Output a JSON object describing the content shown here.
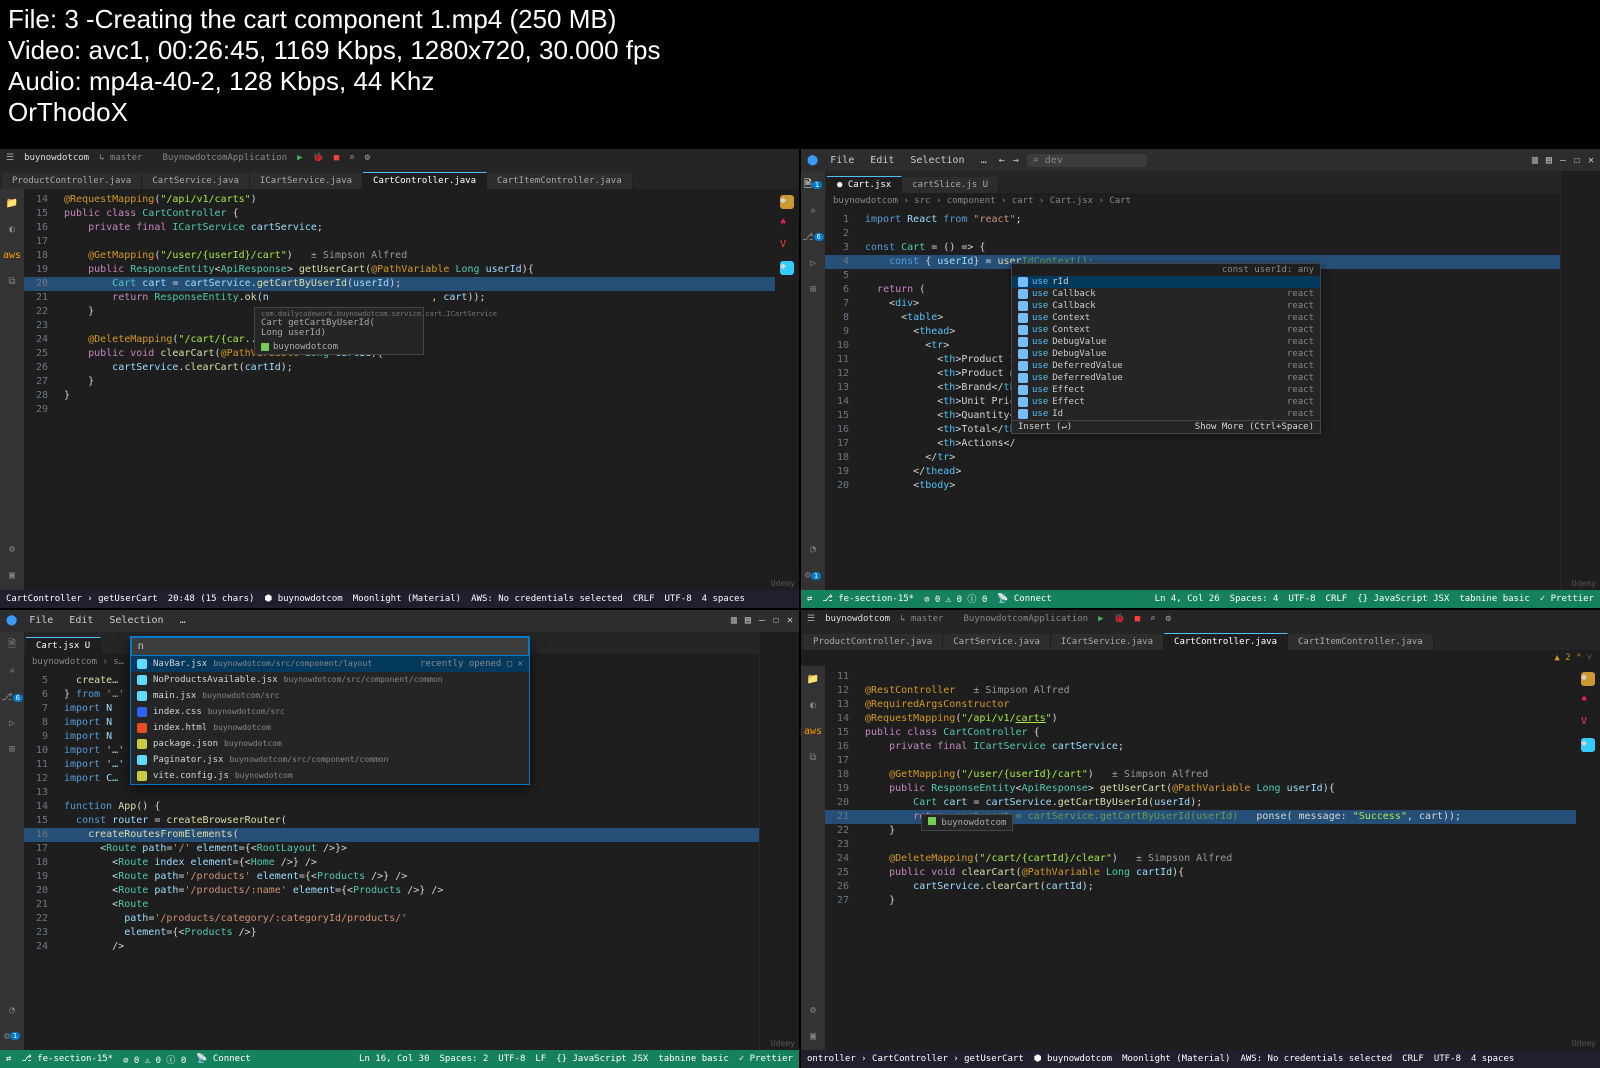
{
  "overlay": {
    "file_line": "File: 3 -Creating the cart component 1.mp4 (250 MB)",
    "video_line": "Video: avc1, 00:26:45, 1169 Kbps, 1280x720, 30.000 fps",
    "audio_line": "Audio: mp4a-40-2, 128 Kbps, 44 Khz",
    "author": "OrThodoX"
  },
  "pane_tl": {
    "project": "buynowdotcom",
    "branch": "master",
    "run_config": "BuynowdotcomApplication",
    "tabs": [
      {
        "label": "ProductController.java",
        "active": false
      },
      {
        "label": "CartService.java",
        "active": false
      },
      {
        "label": "ICartService.java",
        "active": false
      },
      {
        "label": "CartController.java",
        "active": true
      },
      {
        "label": "CartItemController.java",
        "active": false
      }
    ],
    "breadcrumb": "CartController  ›  getUserCart",
    "code_lines": [
      {
        "n": 14,
        "html": "<span class='ann'>@RequestMapping</span>(<span class='str'>\"/api/v1/carts\"</span>)"
      },
      {
        "n": 15,
        "html": "<span class='kw'>public class</span> <span class='type'>CartController</span> {"
      },
      {
        "n": 16,
        "html": "    <span class='kw'>private final</span> <span class='type'>ICartService</span> <span class='attr'>cartService</span>;"
      },
      {
        "n": 17,
        "html": ""
      },
      {
        "n": 18,
        "html": "    <span class='ann'>@GetMapping</span>(<span class='str'>\"/user/{userId}/cart\"</span>)   <span class='avatar'>± Simpson Alfred</span>"
      },
      {
        "n": 19,
        "html": "    <span class='kw'>public</span> <span class='type'>ResponseEntity</span>&lt;<span class='type'>ApiResponse</span>&gt; <span class='fn'>getUserCart</span>(<span class='ann'>@PathVariable</span> <span class='type'>Long</span> <span class='attr'>userId</span>){"
      },
      {
        "n": 20,
        "html": "        <span class='type'>Cart</span> <span class='attr'>cart</span> = <span class='attr'>cartService</span>.<span class='fn'>getCartByUserId</span>(<span class='attr'>userId</span>);",
        "hl": true
      },
      {
        "n": 21,
        "html": "        <span class='kw'>return</span> <span class='type'>ResponseEntity</span>.<span class='fn'>ok</span>(<span class='attr'>n</span>                           , <span class='attr'>cart</span>));"
      },
      {
        "n": 22,
        "html": "    }"
      },
      {
        "n": 23,
        "html": ""
      },
      {
        "n": 24,
        "html": "    <span class='ann'>@DeleteMapping</span>(<span class='str'>\"/cart/{car...\"</span>)"
      },
      {
        "n": 25,
        "html": "    <span class='kw'>public void</span> <span class='fn'>clearCart</span>(<span class='ann'>@PathVariable</span> <span class='type'>Long</span> <span class='attr'>cartId</span>){"
      },
      {
        "n": 26,
        "html": "        <span class='attr'>cartService</span>.<span class='fn'>clearCart</span>(<span class='attr'>cartId</span>);"
      },
      {
        "n": 27,
        "html": "    }"
      },
      {
        "n": 28,
        "html": "}"
      },
      {
        "n": 29,
        "html": ""
      }
    ],
    "tooltip1": "com.dailycodework.buynowdotcom.service.cart.ICartService",
    "tooltip2": "Cart getCartByUserId(",
    "tooltip3": "Long userId)",
    "tooltip_brand": "buynowdotcom",
    "status": {
      "left": "CartController  ›  getUserCart",
      "pos": "20:48 (15 chars)",
      "git": "buynowdotcom",
      "theme": "Moonlight (Material)",
      "aws": "AWS: No credentials selected",
      "eol": "CRLF",
      "enc": "UTF-8",
      "indent": "4 spaces"
    }
  },
  "pane_tr": {
    "menu": [
      "File",
      "Edit",
      "Selection",
      "…"
    ],
    "search_placeholder": "dev",
    "tabs": [
      {
        "label": "Cart.jsx",
        "active": true,
        "dirty": true
      },
      {
        "label": "cartSlice.js  U",
        "active": false
      }
    ],
    "breadcrumb": "buynowdotcom › src › component › cart › Cart.jsx › Cart",
    "code_lines": [
      {
        "n": 1,
        "html": "<span class='kwjs'>import</span> <span class='attr'>React</span> <span class='kwjs'>from</span> <span class='str2'>\"react\"</span>;"
      },
      {
        "n": 2,
        "html": ""
      },
      {
        "n": 3,
        "html": "<span class='kwjs'>const</span> <span class='type'>Cart</span> = () =&gt; {"
      },
      {
        "n": 4,
        "html": "    <span class='kwjs'>const</span> { <span class='attr'>userId</span>} = <span class='fn'>user</span><span class='cmt'>IdContext();</span>",
        "hl": true
      },
      {
        "n": 5,
        "html": ""
      },
      {
        "n": 6,
        "html": "  <span class='kw'>return</span> ("
      },
      {
        "n": 7,
        "html": "    &lt;<span class='tagname'>div</span>&gt;"
      },
      {
        "n": 8,
        "html": "      &lt;<span class='tagname'>table</span>&gt;"
      },
      {
        "n": 9,
        "html": "        &lt;<span class='tagname'>thead</span>&gt;"
      },
      {
        "n": 10,
        "html": "          &lt;<span class='tagname'>tr</span>&gt;"
      },
      {
        "n": 11,
        "html": "            &lt;<span class='tagname'>th</span>&gt;Product I"
      },
      {
        "n": 12,
        "html": "            &lt;<span class='tagname'>th</span>&gt;Product n"
      },
      {
        "n": 13,
        "html": "            &lt;<span class='tagname'>th</span>&gt;Brand&lt;/<span class='tagname'>th</span>"
      },
      {
        "n": 14,
        "html": "            &lt;<span class='tagname'>th</span>&gt;Unit Pric"
      },
      {
        "n": 15,
        "html": "            &lt;<span class='tagname'>th</span>&gt;Quantity&lt;"
      },
      {
        "n": 16,
        "html": "            &lt;<span class='tagname'>th</span>&gt;Total&lt;/<span class='tagname'>th</span>"
      },
      {
        "n": 17,
        "html": "            &lt;<span class='tagname'>th</span>&gt;Actions&lt;/"
      },
      {
        "n": 18,
        "html": "          &lt;/<span class='tagname'>tr</span>&gt;"
      },
      {
        "n": 19,
        "html": "        &lt;/<span class='tagname'>thead</span>&gt;"
      },
      {
        "n": 20,
        "html": "        &lt;<span class='tagname'>tbody</span>&gt;"
      }
    ],
    "intellisense_header": "const userId: any",
    "intellisense": [
      {
        "label": "userId",
        "src": "",
        "sel": true
      },
      {
        "label": "useCallback",
        "src": "react"
      },
      {
        "label": "useCallback",
        "src": "react"
      },
      {
        "label": "useContext",
        "src": "react"
      },
      {
        "label": "useContext",
        "src": "react"
      },
      {
        "label": "useDebugValue",
        "src": "react"
      },
      {
        "label": "useDebugValue",
        "src": "react"
      },
      {
        "label": "useDeferredValue",
        "src": "react"
      },
      {
        "label": "useDeferredValue",
        "src": "react"
      },
      {
        "label": "useEffect",
        "src": "react"
      },
      {
        "label": "useEffect",
        "src": "react"
      },
      {
        "label": "useId",
        "src": "react"
      }
    ],
    "intellisense_footer_left": "Insert (↵)",
    "intellisense_footer_right": "Show More (Ctrl+Space)",
    "status": {
      "branch": "fe-section-15*",
      "errs": "⊘ 0  ⚠ 0  ⓘ 0",
      "connect": "Connect",
      "pos": "Ln 4, Col 26",
      "indent": "Spaces: 4",
      "enc": "UTF-8",
      "eol": "CRLF",
      "lang": "JavaScript JSX",
      "tabnine": "tabnine basic",
      "prettier": "Prettier"
    }
  },
  "pane_bl": {
    "menu": [
      "File",
      "Edit",
      "Selection",
      "…"
    ],
    "tabs": [
      {
        "label": "Cart.jsx  U",
        "active": true
      }
    ],
    "breadcrumb": "buynowdotcom › s…",
    "quickopen_input": "n",
    "quickopen": [
      {
        "name": "NavBar.jsx",
        "path": "buynowdotcom/src/component/layout",
        "right": "recently opened",
        "sel": true
      },
      {
        "name": "NoProductsAvailable.jsx",
        "path": "buynowdotcom/src/component/common"
      },
      {
        "name": "main.jsx",
        "path": "buynowdotcom/src"
      },
      {
        "name": "index.css",
        "path": "buynowdotcom/src"
      },
      {
        "name": "index.html",
        "path": "buynowdotcom"
      },
      {
        "name": "package.json",
        "path": "buynowdotcom"
      },
      {
        "name": "Paginator.jsx",
        "path": "buynowdotcom/src/component/common"
      },
      {
        "name": "vite.config.js",
        "path": "buynowdotcom"
      }
    ],
    "code_lines": [
      {
        "n": 5,
        "html": "  <span class='fn'>create</span>…"
      },
      {
        "n": 6,
        "html": "} <span class='kwjs'>from</span> <span class='str2'>'…'</span>"
      },
      {
        "n": 7,
        "html": "<span class='kwjs'>import</span> <span class='attr'>N</span>"
      },
      {
        "n": 8,
        "html": "<span class='kwjs'>import</span> <span class='attr'>N</span>"
      },
      {
        "n": 9,
        "html": "<span class='kwjs'>import</span> <span class='attr'>N</span>"
      },
      {
        "n": 10,
        "html": "<span class='kwjs'>import</span> <span class='attr'>'…'</span>"
      },
      {
        "n": 11,
        "html": "<span class='kwjs'>import</span> <span class='attr'>'…'</span>"
      },
      {
        "n": 12,
        "html": "<span class='kwjs'>import</span> <span class='attr'>C…</span>"
      },
      {
        "n": 13,
        "html": ""
      },
      {
        "n": 14,
        "html": "<span class='kwjs'>function</span> <span class='fn'>App</span>() {"
      },
      {
        "n": 15,
        "html": "  <span class='kwjs'>const</span> <span class='attr'>router</span> = <span class='fn'>createBrowserRouter</span>("
      },
      {
        "n": 16,
        "html": "    <span class='fn'>createRoutesFromElements</span>(",
        "hl": true
      },
      {
        "n": 17,
        "html": "      &lt;<span class='type'>Route</span> <span class='attr'>path</span>=<span class='str2'>'/'</span> <span class='attr'>element</span>={&lt;<span class='type'>RootLayout</span> /&gt;}&gt;"
      },
      {
        "n": 18,
        "html": "        &lt;<span class='type'>Route</span> <span class='attr'>index</span> <span class='attr'>element</span>={&lt;<span class='type'>Home</span> /&gt;} /&gt;"
      },
      {
        "n": 19,
        "html": "        &lt;<span class='type'>Route</span> <span class='attr'>path</span>=<span class='str2'>'/products'</span> <span class='attr'>element</span>={&lt;<span class='type'>Products</span> /&gt;} /&gt;"
      },
      {
        "n": 20,
        "html": "        &lt;<span class='type'>Route</span> <span class='attr'>path</span>=<span class='str2'>'/products/:name'</span> <span class='attr'>element</span>={&lt;<span class='type'>Products</span> /&gt;} /&gt;"
      },
      {
        "n": 21,
        "html": "        &lt;<span class='type'>Route</span>"
      },
      {
        "n": 22,
        "html": "          <span class='attr'>path</span>=<span class='str2'>'/products/category/:categoryId/products/'</span>"
      },
      {
        "n": 23,
        "html": "          <span class='attr'>element</span>={&lt;<span class='type'>Products</span> /&gt;}"
      },
      {
        "n": 24,
        "html": "        /&gt;"
      }
    ],
    "status": {
      "branch": "fe-section-15*",
      "errs": "⊘ 0  ⚠ 0  ⓘ 0",
      "connect": "Connect",
      "pos": "Ln 16, Col 30",
      "indent": "Spaces: 2",
      "enc": "UTF-8",
      "eol": "LF",
      "lang": "JavaScript JSX",
      "tabnine": "tabnine basic",
      "prettier": "Prettier"
    }
  },
  "pane_br": {
    "project": "buynowdotcom",
    "branch": "master",
    "run_config": "BuynowdotcomApplication",
    "tabs": [
      {
        "label": "ProductController.java",
        "active": false
      },
      {
        "label": "CartService.java",
        "active": false
      },
      {
        "label": "ICartService.java",
        "active": false
      },
      {
        "label": "CartController.java",
        "active": true
      },
      {
        "label": "CartItemController.java",
        "active": false
      }
    ],
    "breadcrumb_warn": "▲ 2  ⌃ ˅",
    "code_lines": [
      {
        "n": 11,
        "html": ""
      },
      {
        "n": 12,
        "html": "<span class='ann'>@RestController</span>   <span class='avatar'>± Simpson Alfred</span>"
      },
      {
        "n": 13,
        "html": "<span class='ann'>@RequiredArgsConstructor</span>"
      },
      {
        "n": 14,
        "html": "<span class='ann'>@RequestMapping</span>(<span class='str'>\"/api/v1/<u>carts</u>\"</span>)"
      },
      {
        "n": 15,
        "html": "<span class='kw'>public class</span> <span class='type'>CartController</span> {"
      },
      {
        "n": 16,
        "html": "    <span class='kw'>private final</span> <span class='type'>ICartService</span> <span class='attr'>cartService</span>;"
      },
      {
        "n": 17,
        "html": ""
      },
      {
        "n": 18,
        "html": "    <span class='ann'>@GetMapping</span>(<span class='str'>\"/user/{userId}/cart\"</span>)   <span class='avatar'>± Simpson Alfred</span>"
      },
      {
        "n": 19,
        "html": "    <span class='kw'>public</span> <span class='type'>ResponseEntity</span>&lt;<span class='type'>ApiResponse</span>&gt; <span class='fn'>getUserCart</span>(<span class='ann'>@PathVariable</span> <span class='type'>Long</span> <span class='attr'>userId</span>){"
      },
      {
        "n": 20,
        "html": "        <span class='type'>Cart</span> <span class='attr'>cart</span> = <span class='attr'>cartService</span>.<span class='fn'>getCartByUserId</span>(<span class='attr'>userId</span>);"
      },
      {
        "n": 21,
        "html": "        <span class='kw'>retur</span>  <span class='cmt'>cart cart = cartService.getCartByUserId(userId)</span>   ponse( message: <span class='str'>\"Success\"</span>, cart));",
        "hl": true
      },
      {
        "n": 22,
        "html": "    }"
      },
      {
        "n": 23,
        "html": ""
      },
      {
        "n": 24,
        "html": "    <span class='ann'>@DeleteMapping</span>(<span class='str'>\"/cart/{cartId}/clear\"</span>)   <span class='avatar'>± Simpson Alfred</span>"
      },
      {
        "n": 25,
        "html": "    <span class='kw'>public void</span> <span class='fn'>clearCart</span>(<span class='ann'>@PathVariable</span> <span class='type'>Long</span> <span class='attr'>cartId</span>){"
      },
      {
        "n": 26,
        "html": "        <span class='attr'>cartService</span>.<span class='fn'>clearCart</span>(<span class='attr'>cartId</span>);"
      },
      {
        "n": 27,
        "html": "    }"
      }
    ],
    "inline_hint": "buynowdotcom",
    "status": {
      "left": "ontroller  ›  CartController  ›  getUserCart",
      "git": "buynowdotcom",
      "theme": "Moonlight (Material)",
      "aws": "AWS: No credentials selected",
      "eol": "CRLF",
      "enc": "UTF-8",
      "indent": "4 spaces"
    }
  },
  "watermark": "Udemy"
}
